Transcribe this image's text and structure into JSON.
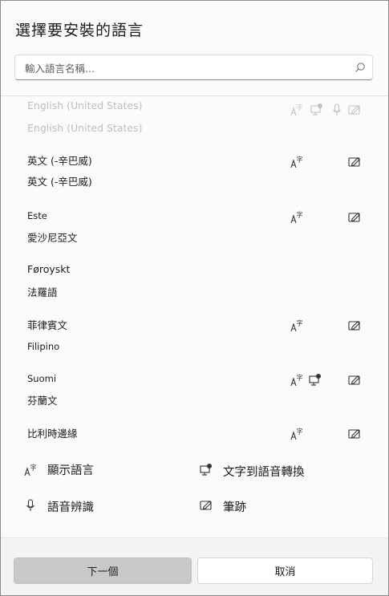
{
  "dialog": {
    "title": "選擇要安裝的語言",
    "search_placeholder": "輸入語言名稱..."
  },
  "languages": [
    {
      "name": "English (United States)",
      "native": "English (United States)",
      "features": [
        "display",
        "tts",
        "speech",
        "handwriting"
      ]
    },
    {
      "name": "英文 (-辛巴威)",
      "native": "英文 (-辛巴威)",
      "features": [
        "display",
        "handwriting"
      ]
    },
    {
      "name": "Este",
      "native": "愛沙尼亞文",
      "features": [
        "display",
        "handwriting"
      ]
    },
    {
      "name": "Føroyskt",
      "native": "法羅語",
      "features": []
    },
    {
      "name": "菲律賓文",
      "native": "Filipino",
      "features": [
        "display",
        "handwriting"
      ]
    },
    {
      "name": "Suomi",
      "native": "芬蘭文",
      "features": [
        "display",
        "tts",
        "handwriting"
      ]
    },
    {
      "name": "比利時邊緣",
      "native": "",
      "features": [
        "display",
        "handwriting"
      ]
    }
  ],
  "legend": {
    "display": "顯示語言",
    "tts": "文字到語音轉換",
    "speech": "語音辨識",
    "handwriting": "筆跡"
  },
  "footer": {
    "next_label": "下一個",
    "cancel_label": "取消"
  }
}
